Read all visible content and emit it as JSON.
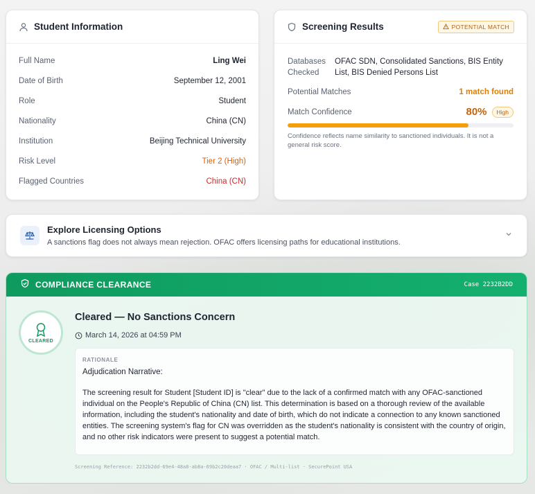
{
  "student": {
    "title": "Student Information",
    "fields": [
      {
        "label": "Full Name",
        "value": "Ling Wei"
      },
      {
        "label": "Date of Birth",
        "value": "September 12, 2001"
      },
      {
        "label": "Role",
        "value": "Student"
      },
      {
        "label": "Nationality",
        "value": "China (CN)"
      },
      {
        "label": "Institution",
        "value": "Beijing Technical University"
      },
      {
        "label": "Risk Level",
        "value": "Tier 2 (High)"
      },
      {
        "label": "Flagged Countries",
        "value": "China (CN)"
      }
    ]
  },
  "screening": {
    "title": "Screening Results",
    "badge": "POTENTIAL MATCH",
    "databases_label_1": "Databases",
    "databases_label_2": "Checked",
    "databases_value": "OFAC SDN, Consolidated Sanctions, BIS Entity List, BIS Denied Persons List",
    "potential_matches_label": "Potential Matches",
    "potential_matches_value": "1 match found",
    "confidence_label": "Match Confidence",
    "confidence_value": "80%",
    "confidence_fraction": 0.8,
    "confidence_badge": "High",
    "confidence_note": "Confidence reflects name similarity to sanctioned individuals. It is not a general risk score."
  },
  "licensing": {
    "title": "Explore Licensing Options",
    "subtitle": "A sanctions flag does not always mean rejection. OFAC offers licensing paths for educational institutions."
  },
  "clearance": {
    "header": "COMPLIANCE CLEARANCE",
    "case": "Case  2232B2DD",
    "seal_text": "CLEARED",
    "heading": "Cleared — No Sanctions Concern",
    "date": "March 14, 2026 at 04:59 PM",
    "rationale_label": "RATIONALE",
    "rationale_head": "Adjudication Narrative:",
    "rationale_text": "The screening result for Student [Student ID] is \"clear\" due to the lack of a confirmed match with any OFAC-sanctioned individual on the People's Republic of China (CN) list. This determination is based on a thorough review of the available information, including the student's nationality and date of birth, which do not indicate a connection to any known sanctioned entities. The screening system's flag for CN was overridden as the student's nationality is consistent with the country of origin, and no other risk indicators were present to suggest a potential match.",
    "reference": "Screening Reference: 2232b2dd-69e4-48a8-ab8a-69b2c20deaa7 · OFAC / Multi-list · SecurePoint USA"
  },
  "colors": {
    "accent_green": "#0f9a5f",
    "warning_orange": "#f59d0b",
    "danger_red": "#cc2a2a"
  }
}
